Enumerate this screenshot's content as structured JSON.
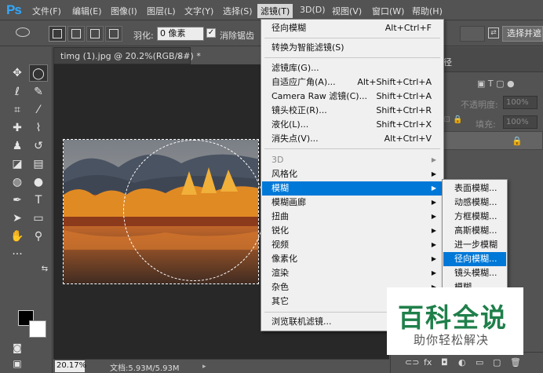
{
  "app": {
    "logo": "Ps"
  },
  "menubar": {
    "items": [
      "文件(F)",
      "编辑(E)",
      "图像(I)",
      "图层(L)",
      "文字(Y)",
      "选择(S)",
      "滤镜(T)",
      "3D(D)",
      "视图(V)",
      "窗口(W)",
      "帮助(H)"
    ],
    "active": "滤镜(T)"
  },
  "options": {
    "feather_label": "羽化:",
    "feather_value": "0 像素",
    "antialias_label": "消除锯齿",
    "antialias_checked": "✓",
    "select_button": "选择并遮"
  },
  "document": {
    "tab_title": "timg (1).jpg @ 20.2%(RGB/8#) *",
    "close": "×",
    "zoom": "20.17%",
    "doc_info": "文档:5.93M/5.93M"
  },
  "layers_panel": {
    "tab_fragment": "各径",
    "opacity_label": "不透明度:",
    "opacity_value": "100%",
    "fill_label": "填充:",
    "fill_value": "100%"
  },
  "filter_menu": {
    "last_filter": {
      "label": "径向模糊",
      "shortcut": "Alt+Ctrl+F"
    },
    "smart_filter": "转换为智能滤镜(S)",
    "group1": [
      {
        "label": "滤镜库(G)...",
        "shortcut": ""
      },
      {
        "label": "自适应广角(A)...",
        "shortcut": "Alt+Shift+Ctrl+A"
      },
      {
        "label": "Camera Raw 滤镜(C)...",
        "shortcut": "Shift+Ctrl+A"
      },
      {
        "label": "镜头校正(R)...",
        "shortcut": "Shift+Ctrl+R"
      },
      {
        "label": "液化(L)...",
        "shortcut": "Shift+Ctrl+X"
      },
      {
        "label": "消失点(V)...",
        "shortcut": "Alt+Ctrl+V"
      }
    ],
    "group2": [
      {
        "label": "3D",
        "disabled": true
      },
      {
        "label": "风格化",
        "disabled": false
      },
      {
        "label": "模糊",
        "disabled": false,
        "highlight": true
      },
      {
        "label": "模糊画廊",
        "disabled": false
      },
      {
        "label": "扭曲",
        "disabled": false
      },
      {
        "label": "锐化",
        "disabled": false
      },
      {
        "label": "视频",
        "disabled": false
      },
      {
        "label": "像素化",
        "disabled": false
      },
      {
        "label": "渲染",
        "disabled": false
      },
      {
        "label": "杂色",
        "disabled": false
      },
      {
        "label": "其它",
        "disabled": false
      }
    ],
    "browse": "浏览联机滤镜..."
  },
  "blur_submenu": {
    "items": [
      "表面模糊...",
      "动感模糊...",
      "方框模糊...",
      "高斯模糊...",
      "进一步模糊",
      "径向模糊...",
      "镜头模糊...",
      "模糊"
    ],
    "highlight": "径向模糊..."
  },
  "watermark": {
    "title": "百科全说",
    "subtitle": "助你轻松解决"
  }
}
